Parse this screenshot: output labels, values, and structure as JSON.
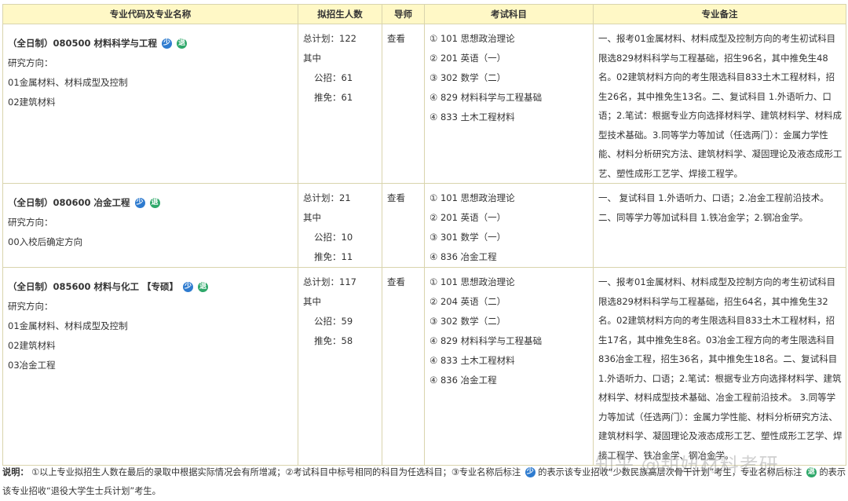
{
  "headers": [
    "专业代码及专业名称",
    "拟招生人数",
    "导师",
    "考试科目",
    "专业备注"
  ],
  "rows": [
    {
      "name": "（全日制）080500 材料科学与工程",
      "badges": [
        "少",
        "退"
      ],
      "research_label": "研究方向：",
      "directions": [
        "01金属材料、材料成型及控制",
        "02建筑材料"
      ],
      "quota": [
        "总计划：122",
        "其中",
        "公招：61",
        "推免：61"
      ],
      "advisor": "查看",
      "subjects": [
        "① 101 思想政治理论",
        "② 201 英语（一）",
        "③ 302 数学（二）",
        "④ 829 材料科学与工程基础",
        "④ 833 土木工程材料"
      ],
      "notes": "一、报考01金属材料、材料成型及控制方向的考生初试科目限选829材料科学与工程基础，招生96名，其中推免生48名。02建筑材料方向的考生限选科目833土木工程材料，招生26名，其中推免生13名。二、复试科目 1.外语听力、口语；2.笔试：根据专业方向选择材料学、建筑材料学、材料成型技术基础。3.同等学力等加试（任选两门）：金属力学性能、材料分析研究方法、建筑材料学、凝固理论及液态成形工艺、塑性成形工艺学、焊接工程学。"
    },
    {
      "name": "（全日制）080600 冶金工程",
      "badges": [
        "少",
        "退"
      ],
      "research_label": "研究方向：",
      "directions": [
        "00入校后确定方向"
      ],
      "quota": [
        "总计划：21",
        "其中",
        "公招：10",
        "推免：11"
      ],
      "advisor": "查看",
      "subjects": [
        "① 101 思想政治理论",
        "② 201 英语（一）",
        "③ 301 数学（一）",
        "④ 836 冶金工程"
      ],
      "notes": "一、 复试科目 1.外语听力、口语；2.冶金工程前沿技术。二、同等学力等加试科目 1.铁冶金学；2.钢冶金学。"
    },
    {
      "name": "（全日制）085600 材料与化工 【专硕】",
      "badges": [
        "少",
        "退"
      ],
      "research_label": "研究方向：",
      "directions": [
        "01金属材料、材料成型及控制",
        "02建筑材料",
        "03冶金工程"
      ],
      "quota": [
        "总计划：117",
        "其中",
        "公招：59",
        "推免：58"
      ],
      "advisor": "查看",
      "subjects": [
        "① 101 思想政治理论",
        "② 204 英语（二）",
        "③ 302 数学（二）",
        "④ 829 材料科学与工程基础",
        "④ 833 土木工程材料",
        "④ 836 冶金工程"
      ],
      "notes": "一、报考01金属材料、材料成型及控制方向的考生初试科目限选829材料科学与工程基础，招生64名，其中推免生32名。02建筑材料方向的考生限选科目833土木工程材料，招生17名，其中推免生8名。03冶金工程方向的考生限选科目836冶金工程，招生36名，其中推免生18名。二、复试科目 1.外语听力、口语；2.笔试：根据专业方向选择材料学、建筑材料学、材料成型技术基础、冶金工程前沿技术。 3.同等学力等加试（任选两门）：金属力学性能、材料分析研究方法、建筑材料学、凝固理论及液态成形工艺、塑性成形工艺学、焊接工程学、铁冶金学、钢冶金学。"
    }
  ],
  "footer": {
    "label": "说明：",
    "text1": "①以上专业拟招生人数在最后的录取中根据实际情况会有所增减；②考试科目中标号相同的科目为任选科目；③专业名称后标注",
    "badge1": "少",
    "text2": "的表示该专业招收“少数民族高层次骨干计划”考生，专业名称后标注",
    "badge2": "退",
    "text3": "的表示该专业招收“退役大学生士兵计划”考生。"
  },
  "watermark": "知乎 @甜妞材料考研",
  "colors": {
    "header_bg": "#fff8c6",
    "border": "#d9d4ad",
    "badge_blue": "#2e7bcf",
    "badge_green": "#2fa86a"
  }
}
